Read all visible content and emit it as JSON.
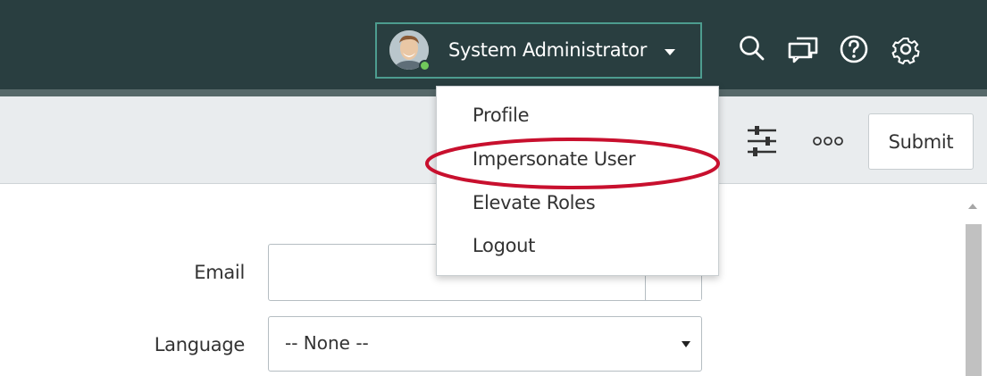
{
  "header": {
    "user_name": "System Administrator",
    "icons": [
      "search-icon",
      "chat-icon",
      "help-icon",
      "settings-icon"
    ],
    "colors": {
      "bar": "#293e40",
      "accent_border": "#4d9c8f",
      "presence": "#71c95b"
    }
  },
  "user_menu": {
    "items": [
      {
        "label": "Profile"
      },
      {
        "label": "Impersonate User"
      },
      {
        "label": "Elevate Roles"
      },
      {
        "label": "Logout"
      }
    ],
    "highlighted_item": "Impersonate User",
    "highlight_color": "#c8102e"
  },
  "form_header": {
    "icons": [
      "personalize-form-icon",
      "more-options-icon"
    ],
    "submit_label": "Submit"
  },
  "form": {
    "email": {
      "label": "Email",
      "value": ""
    },
    "language": {
      "label": "Language",
      "value": "-- None --"
    }
  }
}
